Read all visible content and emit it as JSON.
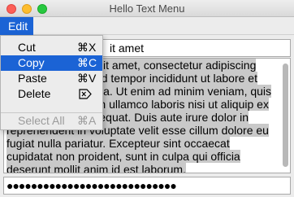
{
  "window": {
    "title": "Hello Text Menu"
  },
  "menubar": {
    "edit_label": "Edit"
  },
  "menu": {
    "items": [
      {
        "label": "Cut",
        "shortcut": "⌘X"
      },
      {
        "label": "Copy",
        "shortcut": "⌘C"
      },
      {
        "label": "Paste",
        "shortcut": "⌘V"
      },
      {
        "label": "Delete",
        "shortcut_icon": "delete-forward-icon"
      },
      {
        "label": "Select All",
        "shortcut": "⌘A"
      }
    ]
  },
  "input": {
    "value_visible": "it amet"
  },
  "textarea": {
    "lines": [
      "orem ipsum dolor sit amet, consectetur adipiscing",
      "elit, sed do eiusmod tempor incididunt ut labore et",
      "dolore magna aliqua. Ut enim ad minim veniam, quis",
      "nostrud exercitation ullamco laboris nisi ut aliquip ex",
      "ea commodo consequat. Duis aute irure dolor in",
      "reprehenderit in voluptate velit esse cillum dolore eu",
      "fugiat nulla pariatur. Excepteur sint occaecat",
      "cupidatat non proident, sunt in culpa qui officia",
      "deserunt mollit anim id est laborum."
    ]
  },
  "password": {
    "masked": "●●●●●●●●●●●●●●●●●●●●●●●●●●●●"
  }
}
